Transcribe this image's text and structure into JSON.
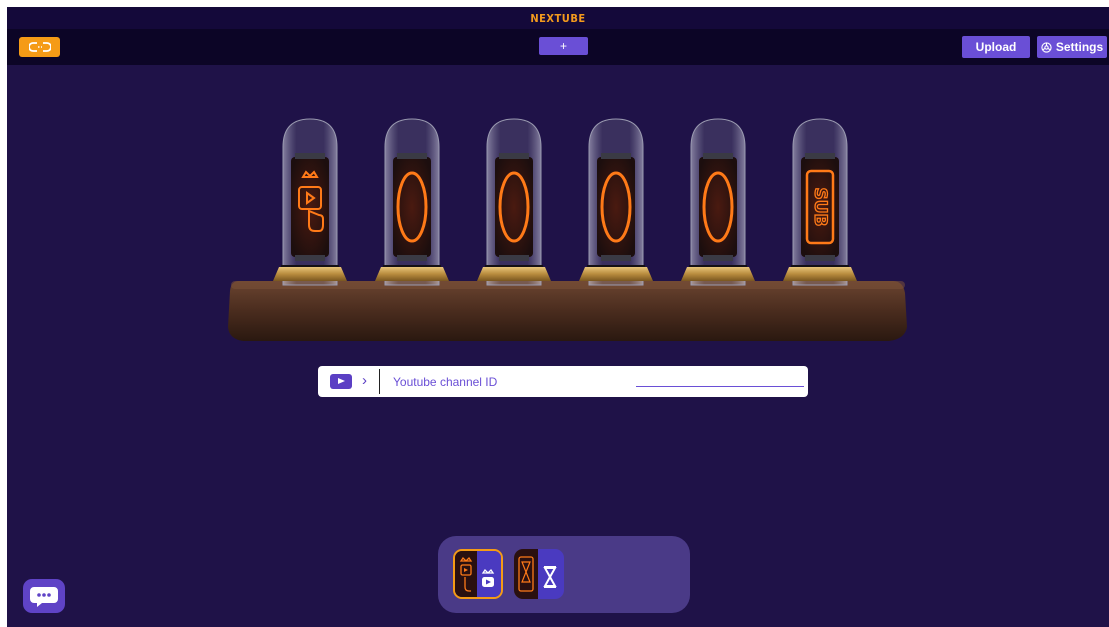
{
  "app": {
    "title": "NEXTUBE"
  },
  "toolbar": {
    "link_icon": "link-icon",
    "add_label": "+",
    "upload_label": "Upload",
    "settings_label": "Settings",
    "settings_icon": "gear-icon"
  },
  "device": {
    "tubes": [
      {
        "symbol": "play-hand-icon"
      },
      {
        "symbol": "0"
      },
      {
        "symbol": "0"
      },
      {
        "symbol": "0"
      },
      {
        "symbol": "0"
      },
      {
        "symbol": "SUB"
      }
    ]
  },
  "search": {
    "icon": "youtube-icon",
    "placeholder": "Youtube channel ID",
    "value": ""
  },
  "themes": [
    {
      "name": "youtube-subscriber-theme",
      "selected": true
    },
    {
      "name": "countdown-theme",
      "selected": false
    }
  ],
  "chat": {
    "icon": "chat-icon"
  },
  "colors": {
    "background": "#1f1248",
    "accent": "#6a4fd6",
    "orange": "#f59b16",
    "glow": "#ff6a10"
  }
}
